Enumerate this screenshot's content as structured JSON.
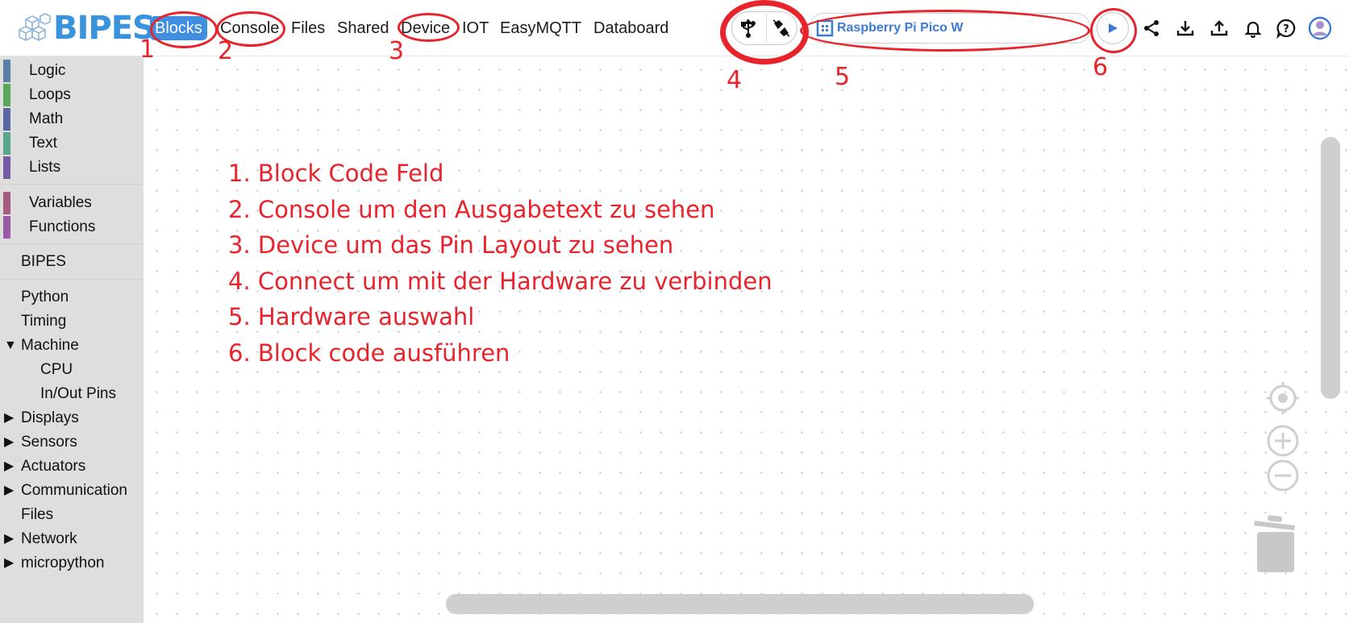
{
  "app": {
    "logo_text": "BIPES",
    "tabs": [
      "Blocks",
      "Console",
      "Files",
      "Shared",
      "Device",
      "IOT",
      "EasyMQTT",
      "Databoard"
    ],
    "active_tab": "Blocks",
    "board_name": "Raspberry Pi Pico W",
    "accent_color": "#3f8ee0",
    "icons": [
      "usb-icon",
      "connect-plug-icon",
      "board-chip-icon",
      "run-icon",
      "share-icon",
      "download-icon",
      "upload-icon",
      "bell-icon",
      "help-icon",
      "account-icon"
    ]
  },
  "sidebar": {
    "categories": [
      {
        "label": "Logic",
        "color": "#5b80a5"
      },
      {
        "label": "Loops",
        "color": "#5ba55b"
      },
      {
        "label": "Math",
        "color": "#5b67a5"
      },
      {
        "label": "Text",
        "color": "#5ba58c"
      },
      {
        "label": "Lists",
        "color": "#745ba5"
      },
      {
        "label": "Variables",
        "color": "#a55b80"
      },
      {
        "label": "Functions",
        "color": "#995ba5"
      }
    ],
    "groups": [
      "BIPES",
      "Python",
      "Timing",
      "Machine",
      "CPU",
      "In/Out Pins",
      "Displays",
      "Sensors",
      "Actuators",
      "Communication",
      "Files",
      "Network",
      "micropython"
    ]
  },
  "annotations": {
    "notes": [
      "1. Block Code Feld",
      "2. Console um den Ausgabetext zu sehen",
      "3. Device um das Pin Layout zu sehen",
      "4. Connect um mit der Hardware zu verbinden",
      "5. Hardware auswahl",
      "6. Block code ausführen"
    ],
    "markers": [
      "1",
      "2",
      "3",
      "4",
      "5",
      "6"
    ],
    "color": "#e8232b"
  }
}
